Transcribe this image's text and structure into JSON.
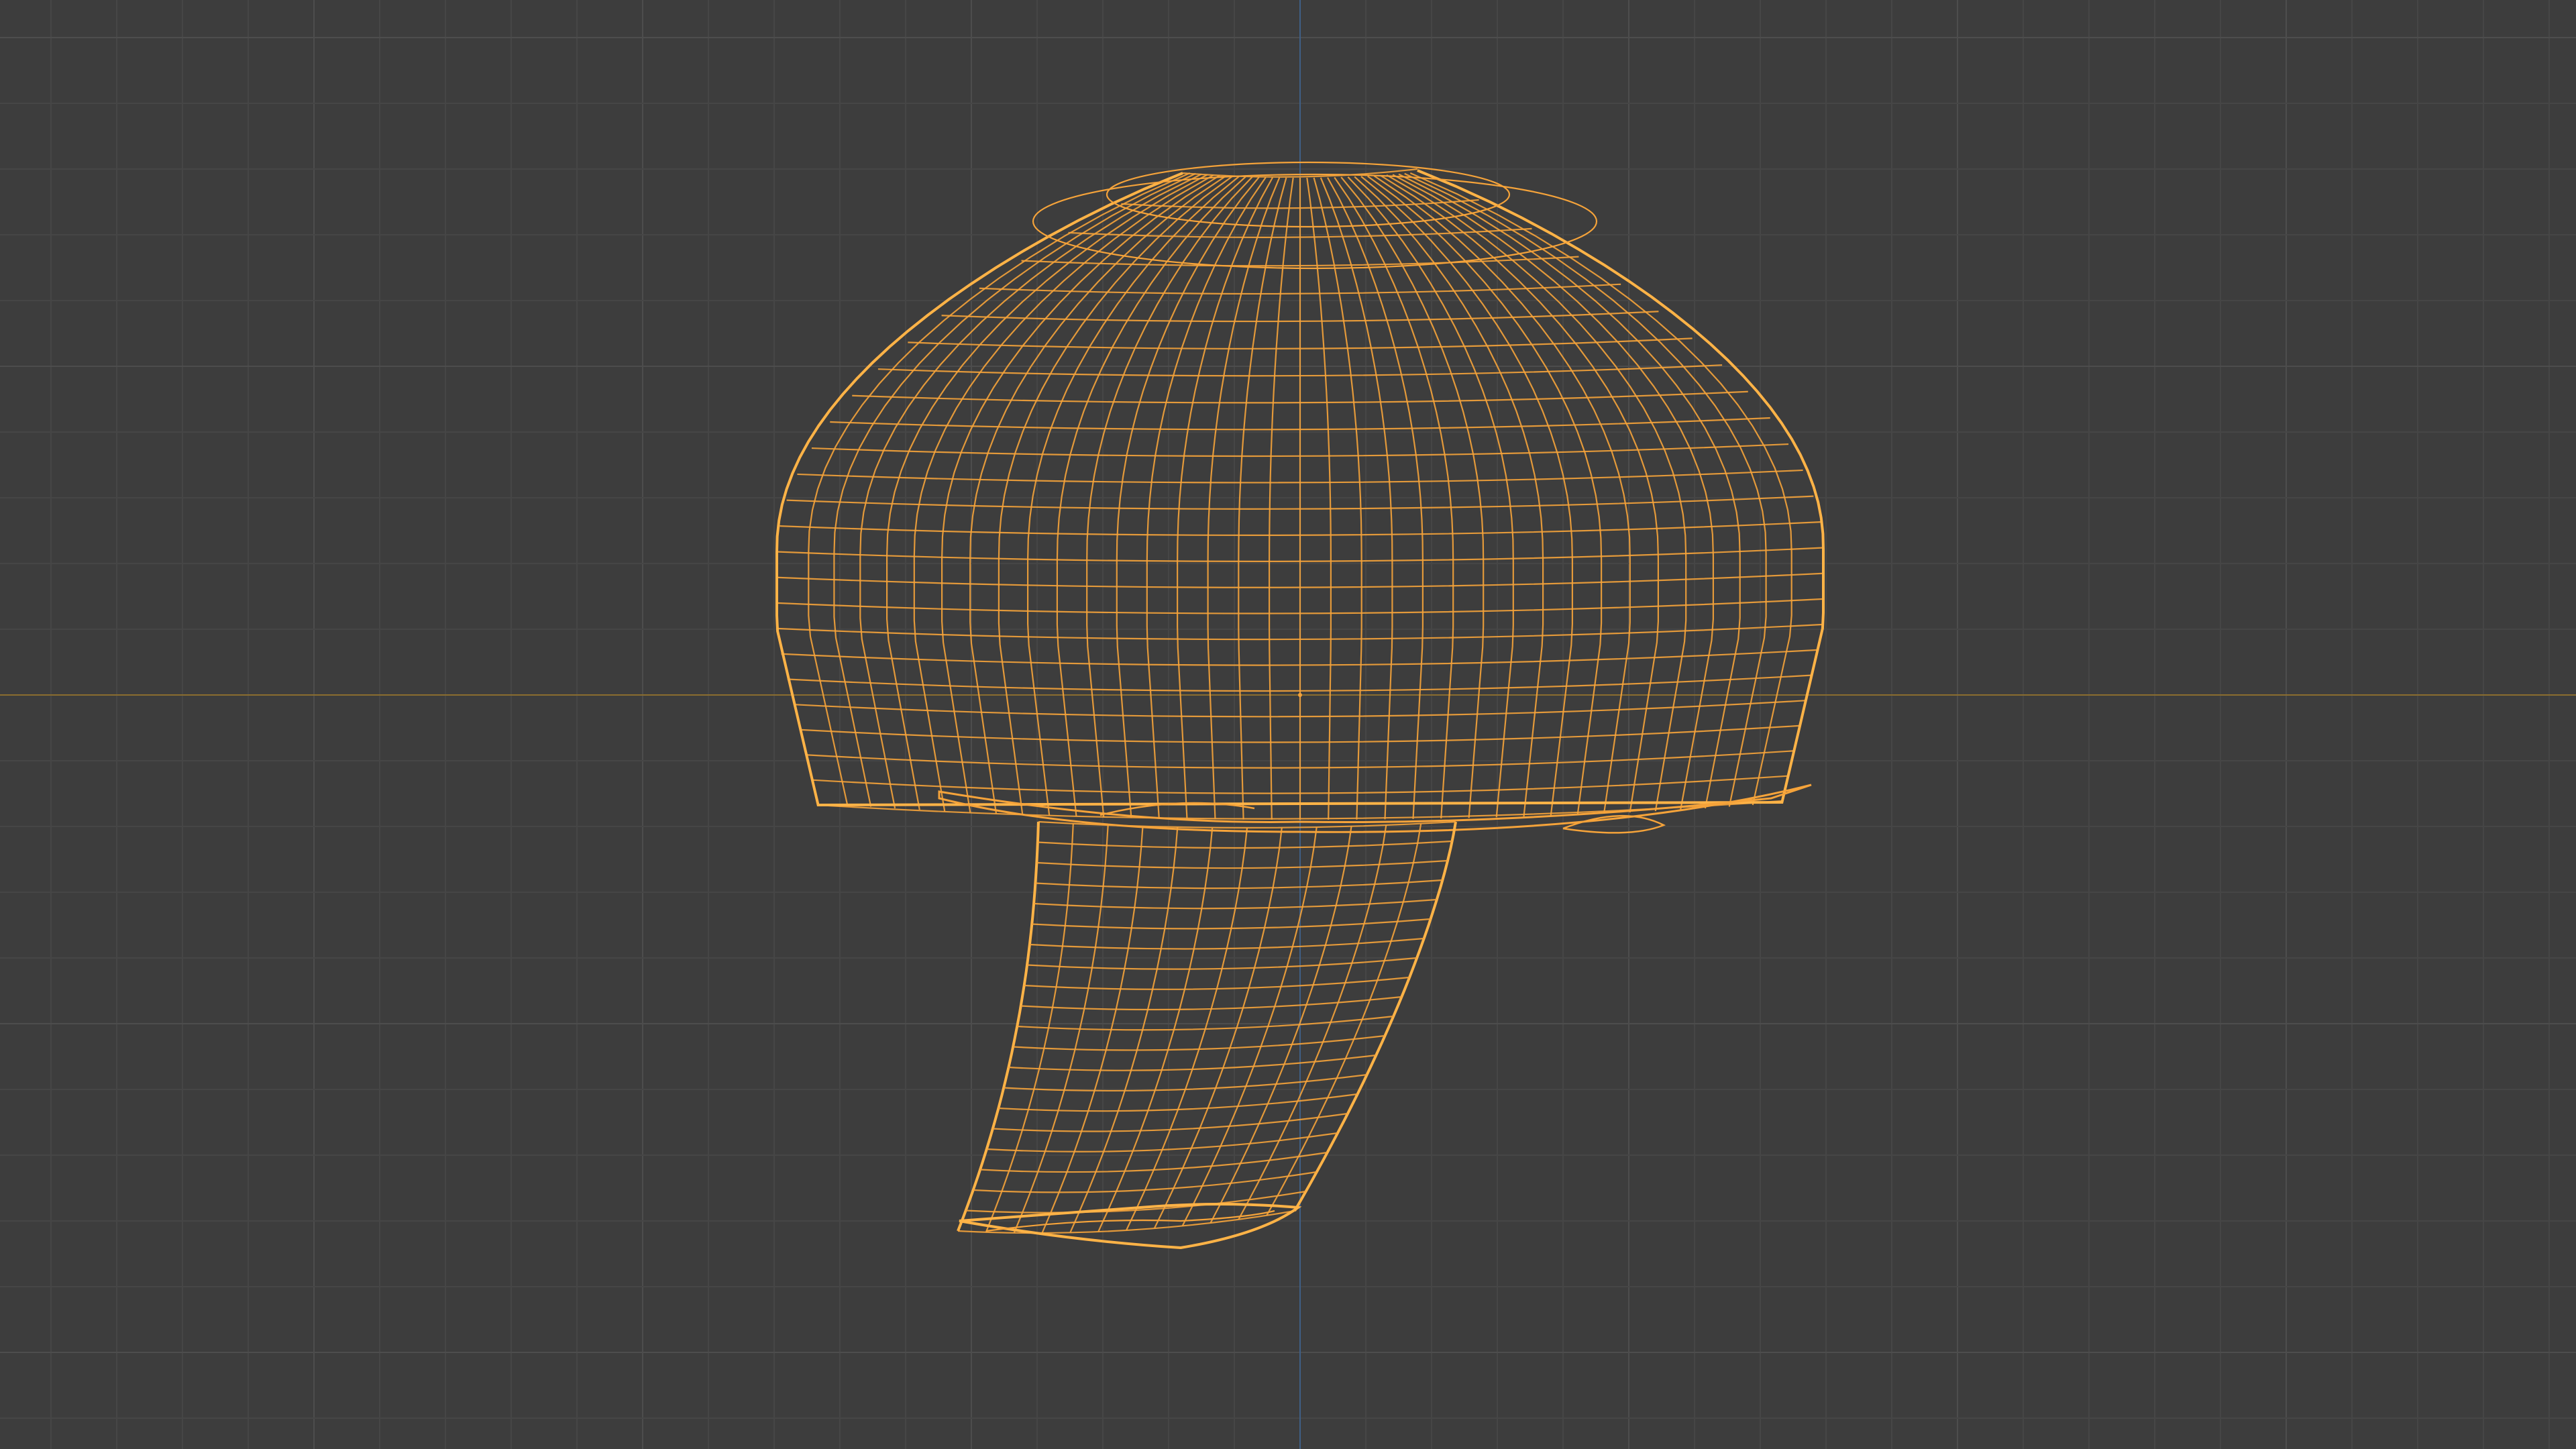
{
  "viewport": {
    "mode": "wireframe",
    "object": "mushroom",
    "selected": true,
    "colors": {
      "background": "#3d3d3d",
      "grid_minor": "#464646",
      "grid_major": "#4d4d4d",
      "axis_x": "#8a6d2f",
      "axis_z": "#3f5f86",
      "wire_selected": "#f5a33a",
      "wire_outline": "#ffb347"
    }
  }
}
